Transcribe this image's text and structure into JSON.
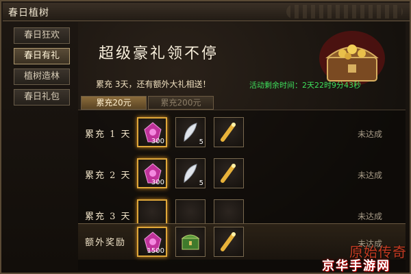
{
  "window": {
    "title": "春日植树"
  },
  "sidebar": {
    "items": [
      {
        "label": "春日狂欢",
        "active": false
      },
      {
        "label": "春日有礼",
        "active": true
      },
      {
        "label": "植树造林",
        "active": false
      },
      {
        "label": "春日礼包",
        "active": false
      }
    ]
  },
  "banner": {
    "title": "超级豪礼领不停",
    "subtitle": "累充 3天，还有额外大礼相送！",
    "timer": "活动剩余时间：2天22时9分43秒"
  },
  "tabs": [
    {
      "label": "累充20元",
      "active": true
    },
    {
      "label": "累充200元",
      "active": false
    }
  ],
  "rows": [
    {
      "label": "累充 1 天",
      "status": "未达成",
      "items": [
        {
          "icon": "gem-icon",
          "qty": "300"
        },
        {
          "icon": "feather-icon",
          "qty": "5"
        },
        {
          "icon": "scroll-icon",
          "qty": ""
        }
      ]
    },
    {
      "label": "累充 2 天",
      "status": "未达成",
      "items": [
        {
          "icon": "gem-icon",
          "qty": "300"
        },
        {
          "icon": "feather-icon",
          "qty": "5"
        },
        {
          "icon": "scroll-icon",
          "qty": ""
        }
      ]
    },
    {
      "label": "累充 3 天",
      "status": "未达成",
      "items": [
        {
          "icon": "gem-icon",
          "qty": ""
        },
        {
          "icon": "feather-icon",
          "qty": ""
        },
        {
          "icon": "scroll-icon",
          "qty": ""
        }
      ]
    }
  ],
  "bonus": {
    "label": "额外奖励",
    "status": "未达成",
    "items": [
      {
        "icon": "gem-icon",
        "qty": "1500"
      },
      {
        "icon": "chest-box-icon",
        "qty": ""
      },
      {
        "icon": "scroll-icon",
        "qty": ""
      }
    ]
  },
  "branding": {
    "game_logo": "原始传奇",
    "watermark": "京华手游网"
  },
  "colors": {
    "timer": "#3ee05c",
    "gold_border": "#e0a83a",
    "panel_border": "#5a4a35"
  }
}
